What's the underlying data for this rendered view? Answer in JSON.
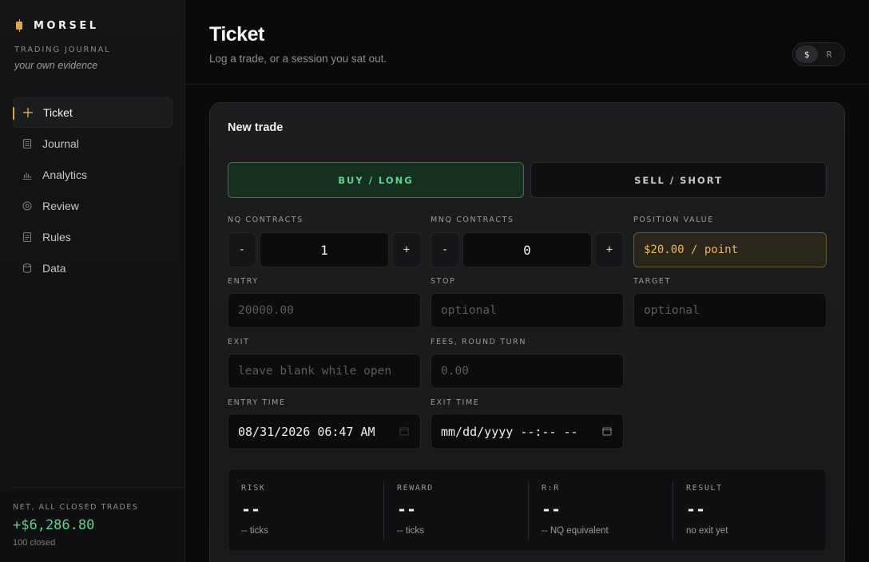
{
  "brand": {
    "name": "MORSEL",
    "subtitle": "TRADING JOURNAL",
    "tagline": "your own evidence",
    "accent": "#d8a84a"
  },
  "nav": {
    "items": [
      {
        "label": "Ticket",
        "icon": "plus-icon",
        "active": true
      },
      {
        "label": "Journal",
        "icon": "document-icon",
        "active": false
      },
      {
        "label": "Analytics",
        "icon": "bar-chart-icon",
        "active": false
      },
      {
        "label": "Review",
        "icon": "eye-icon",
        "active": false
      },
      {
        "label": "Rules",
        "icon": "list-icon",
        "active": false
      },
      {
        "label": "Data",
        "icon": "database-icon",
        "active": false
      }
    ]
  },
  "footer": {
    "label": "NET, ALL CLOSED TRADES",
    "value": "+$6,286.80",
    "count": "100 closed",
    "value_color": "#5ed48a"
  },
  "header": {
    "title": "Ticket",
    "subtitle": "Log a trade, or a session you sat out.",
    "unit_options": [
      "$",
      "R"
    ],
    "unit_selected": "$"
  },
  "form": {
    "title": "New trade",
    "buy_label": "BUY / LONG",
    "sell_label": "SELL / SHORT",
    "nq": {
      "label": "NQ CONTRACTS",
      "value": "1",
      "minus": "-",
      "plus": "+"
    },
    "mnq": {
      "label": "MNQ CONTRACTS",
      "value": "0",
      "minus": "-",
      "plus": "+"
    },
    "position_value": {
      "label": "POSITION VALUE",
      "value": "$20.00 / point"
    },
    "entry": {
      "label": "ENTRY",
      "placeholder": "20000.00",
      "value": ""
    },
    "stop": {
      "label": "STOP",
      "placeholder": "optional",
      "value": ""
    },
    "target": {
      "label": "TARGET",
      "placeholder": "optional",
      "value": ""
    },
    "exit": {
      "label": "EXIT",
      "placeholder": "leave blank while open",
      "value": ""
    },
    "fees": {
      "label": "FEES, ROUND TURN",
      "placeholder": "0.00",
      "value": ""
    },
    "entry_time": {
      "label": "ENTRY TIME",
      "value": "08/31/2026 06:47 AM"
    },
    "exit_time": {
      "label": "EXIT TIME",
      "value": "mm/dd/yyyy --:-- --"
    }
  },
  "summary": [
    {
      "label": "RISK",
      "value": "--",
      "note": "-- ticks"
    },
    {
      "label": "REWARD",
      "value": "--",
      "note": "-- ticks"
    },
    {
      "label": "R:R",
      "value": "--",
      "note": "-- NQ equivalent"
    },
    {
      "label": "RESULT",
      "value": "--",
      "note": "no exit yet"
    }
  ]
}
